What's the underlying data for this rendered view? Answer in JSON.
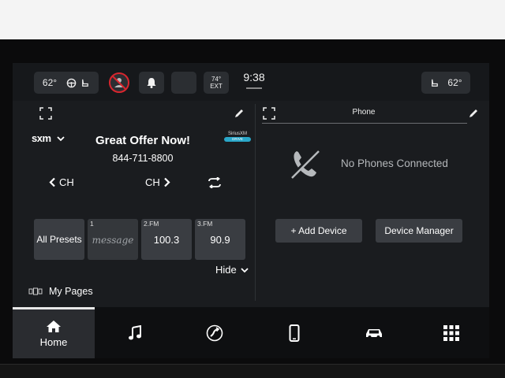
{
  "status_bar": {
    "left_temp": "62°",
    "ext_temp": "74°",
    "ext_label": "EXT",
    "clock": "9:38",
    "right_temp": "62°"
  },
  "radio": {
    "source": "sxm",
    "offer_title": "Great Offer Now!",
    "phone_number": "844-711-8800",
    "badge_top": "SiriusXM",
    "badge_bottom": "DRIVE",
    "ch_prev": "CH",
    "ch_next": "CH",
    "presets": [
      {
        "label": "",
        "value": "All Presets"
      },
      {
        "label": "1",
        "value": "message"
      },
      {
        "label": "2.FM",
        "value": "100.3"
      },
      {
        "label": "3.FM",
        "value": "90.9"
      }
    ],
    "hide_label": "Hide",
    "my_pages_label": "My Pages"
  },
  "phone": {
    "title": "Phone",
    "empty_message": "No Phones Connected",
    "add_device": "+ Add Device",
    "device_manager": "Device Manager"
  },
  "nav": {
    "home_label": "Home",
    "items": [
      "home-icon",
      "music-icon",
      "navigation-icon",
      "phone-icon",
      "car-icon",
      "apps-grid-icon"
    ]
  },
  "colors": {
    "screen_bg": "#1a1c1f",
    "button_bg": "#3a3d42",
    "alert_red": "#d8262e",
    "badge_blue": "#2aa7c9"
  }
}
